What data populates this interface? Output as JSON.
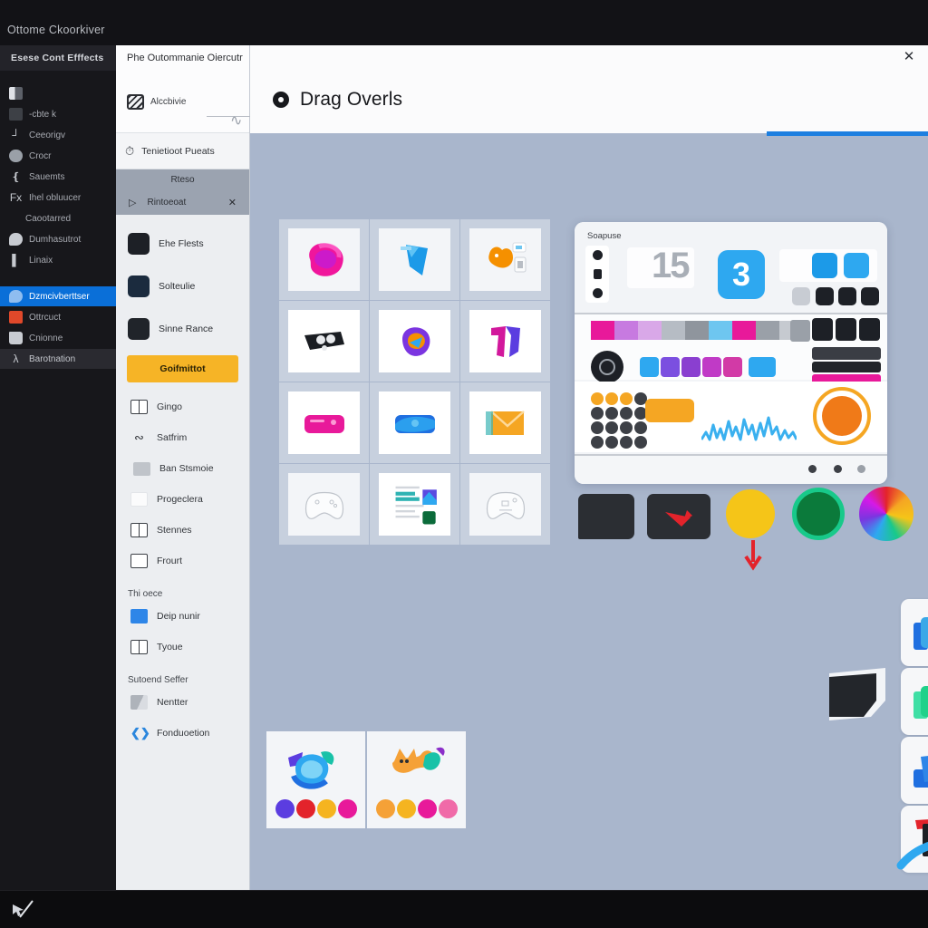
{
  "os": {
    "window_title": "Ottome Ckoorkiver",
    "taskbar_icon": "cursor-pen-icon"
  },
  "sidebar": {
    "header": "Esese Cont Efffects",
    "items": [
      {
        "label": "",
        "icon": "door-icon",
        "state": "normal"
      },
      {
        "label": "-cbte k",
        "icon": "panel-icon",
        "state": "normal"
      },
      {
        "label": "Ceeorigv",
        "icon": "corner-icon",
        "state": "normal"
      },
      {
        "label": "Crocr",
        "icon": "cloud-icon",
        "state": "normal"
      },
      {
        "label": "Sauemts",
        "icon": "bracket-icon",
        "state": "normal"
      },
      {
        "label": "Ihel obluucer",
        "icon": "fx-icon",
        "state": "normal"
      },
      {
        "label": "Caootarred",
        "icon": "none",
        "state": "plain"
      },
      {
        "label": "Dumhasutrot",
        "icon": "bubble-icon",
        "state": "normal"
      },
      {
        "label": "Linaix",
        "icon": "bar-icon",
        "state": "normal"
      },
      {
        "label": "Dzmcivberttser",
        "icon": "bubble-blue-icon",
        "state": "active"
      },
      {
        "label": "Ottrcuct",
        "icon": "red-square-icon",
        "state": "normal"
      },
      {
        "label": "Cnionne",
        "icon": "folder-icon",
        "state": "normal"
      },
      {
        "label": "Barotnation",
        "icon": "lambda-icon",
        "state": "dim"
      }
    ]
  },
  "panel2": {
    "title": "Phe Outommanie Oiercutr",
    "search": {
      "label": "Alccbivie",
      "icon": "hatched-square-icon",
      "squiggle": "wave-glyph"
    },
    "template_row": {
      "label": "Tenietioot Pueats",
      "icon": "clock-icon"
    },
    "selection": {
      "header": "Rteso",
      "row_label": "Rintoeoat",
      "row_icon": "play-icon",
      "close_icon": "close-icon"
    },
    "apps": [
      {
        "label": "Ehe Flests",
        "tile": "t1"
      },
      {
        "label": "Solteulie",
        "tile": "t2"
      },
      {
        "label": "Sinne Rance",
        "tile": "t3"
      }
    ],
    "cta_label": "Goifmittot",
    "list": [
      {
        "label": "Gingo",
        "icon": "layout-icon"
      },
      {
        "label": "Satfrim",
        "icon": "squiggle-icon"
      },
      {
        "label": "Ban Stsmoie",
        "icon": "device-icon"
      },
      {
        "label": "Progeclera",
        "icon": "card-icon"
      },
      {
        "label": "Stennes",
        "icon": "frames-icon"
      },
      {
        "label": "Frourt",
        "icon": "frames2-icon"
      }
    ],
    "sections": [
      {
        "title": "Thi oece",
        "items": [
          {
            "label": "Deip nunir",
            "icon": "blue-square-icon"
          },
          {
            "label": "Tyoue",
            "icon": "frames2-icon"
          }
        ]
      },
      {
        "title": "Sutoend Seffer",
        "items": [
          {
            "label": "Nentter",
            "icon": "wedge-icon"
          },
          {
            "label": "Fonduoetion",
            "icon": "dev-icon"
          }
        ]
      }
    ]
  },
  "main": {
    "close_label": "✕",
    "heading": "Drag Overls",
    "heading_icon": "record-dot-icon",
    "accent_color": "#1d7fe0",
    "background_color": "#a9b6cc",
    "thumbnails": [
      {
        "name": "pink-splash-thumb",
        "variant": "pink-blob",
        "bg": "#f3f5f8"
      },
      {
        "name": "blue-ribbon-thumb",
        "variant": "blue-arrow",
        "bg": "#f3f5f8"
      },
      {
        "name": "orange-fox-thumb",
        "variant": "orange-fox",
        "bg": "#f3f5f8"
      },
      {
        "name": "black-device-thumb",
        "variant": "black-device",
        "bg": "#ffffff"
      },
      {
        "name": "purple-orb-thumb",
        "variant": "purple-orb",
        "bg": "#ffffff"
      },
      {
        "name": "magenta-fold-thumb",
        "variant": "magenta-fold",
        "bg": "#ffffff"
      },
      {
        "name": "pink-card-thumb",
        "variant": "pink-card",
        "bg": "#ffffff"
      },
      {
        "name": "blue-card-thumb",
        "variant": "blue-card",
        "bg": "#ffffff"
      },
      {
        "name": "orange-envelope-thumb",
        "variant": "orange-env",
        "bg": "#ffffff"
      },
      {
        "name": "gamepad-outline-thumb",
        "variant": "gamepad",
        "bg": "#f0f2f5"
      },
      {
        "name": "document-thumb",
        "variant": "document",
        "bg": "#ffffff"
      },
      {
        "name": "gamepad-outline-thumb-2",
        "variant": "gamepad",
        "bg": "#f0f2f5"
      }
    ],
    "snapshot_card": {
      "label": "Soapuse",
      "number_large": "15",
      "number_tile": "3",
      "swatches": [
        "#e91e8c",
        "#c77ae0",
        "#d9a8e8",
        "#b6bcc4",
        "#8f959d",
        "#6ec6f0",
        "#e91e8c",
        "#9aa0a8",
        "#c6cad0"
      ],
      "mini_tiles": [
        "#2ea8f0",
        "#7b4fe0",
        "#8a3fd0",
        "#c03ac6",
        "#d23aa6",
        "#2ea8f0"
      ],
      "dark_rows": [
        "#3a3d44",
        "#23262b",
        "#e8199a"
      ],
      "orange_color": "#f5a623",
      "waveform_color": "#3ab0ef"
    },
    "bottom_cards": [
      {
        "name": "blue-creature-card",
        "dots": [
          "#5b3de0",
          "#e3232b",
          "#f5b420",
          "#e8199a"
        ]
      },
      {
        "name": "orange-creature-card",
        "dots": [
          "#f5a137",
          "#f5b420",
          "#e8199a",
          "#f06aa8"
        ]
      }
    ],
    "top_chips": [
      {
        "name": "dark-chat-chip",
        "color": "#2b2e33"
      },
      {
        "name": "dark-arrow-chip",
        "color": "#2b2e33"
      },
      {
        "name": "yellow-round-chip",
        "color": "#f5c518"
      },
      {
        "name": "green-round-chip",
        "color": "#0b7a3b"
      },
      {
        "name": "rainbow-round-chip",
        "color": "#8b2fc9"
      }
    ],
    "tiles": [
      {
        "name": "blue-folder-tile",
        "color": "#3aa8e8"
      },
      {
        "name": "blue-square-tile",
        "color": "#0b57c7"
      },
      {
        "name": "magenta-tile",
        "color": "#d619e8"
      },
      {
        "name": "red-tile",
        "color": "#ef2013"
      },
      {
        "name": "green-folder-tile",
        "color": "#1fd18a"
      },
      {
        "name": "dark-tile-1",
        "color": "#1c1f24"
      },
      {
        "name": "dark-tile-2",
        "color": "#1c1f24"
      },
      {
        "name": "yellow-tile",
        "color": "#f5c518"
      },
      {
        "name": "blue-fold-tile",
        "color": "#2e86e8"
      },
      {
        "name": "dark-tile-3",
        "color": "#1c1f24"
      },
      {
        "name": "dark-tile-4",
        "color": "#1c1f24"
      },
      {
        "name": "orange-tile",
        "color": "#f59000"
      },
      {
        "name": "red-mark-tile",
        "color": "#1c1f24"
      },
      {
        "name": "dark-tile-5",
        "color": "#1c1f24"
      },
      {
        "name": "gray-tile",
        "color": "#3d4046"
      },
      {
        "name": "white-tile",
        "color": "#ffffff"
      }
    ]
  }
}
